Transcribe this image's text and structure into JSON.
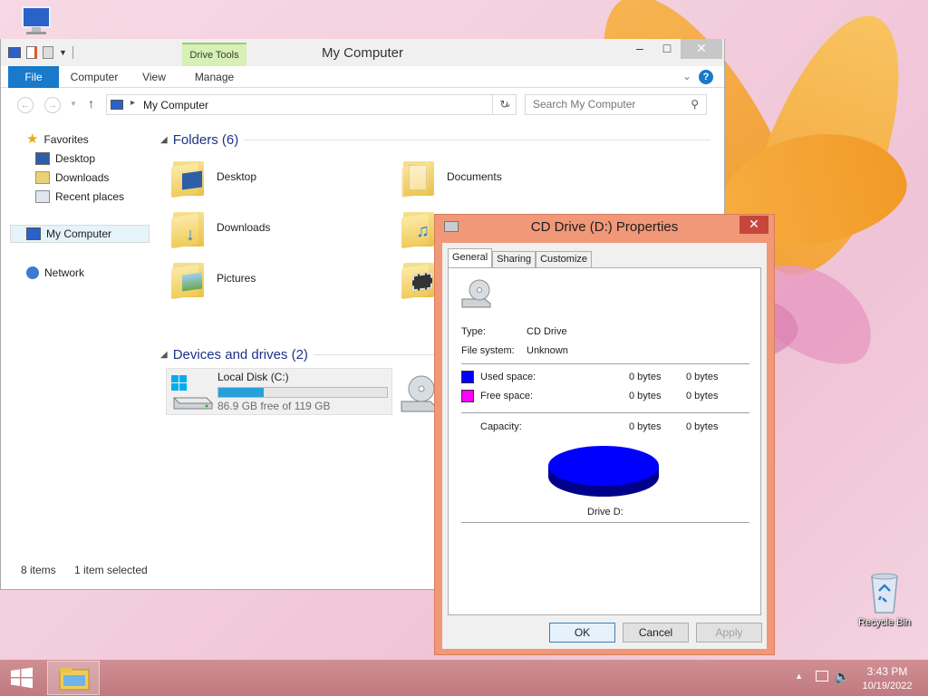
{
  "desktop": {
    "recycle_bin_label": "Recycle Bin"
  },
  "explorer": {
    "title": "My Computer",
    "context_tab": "Drive Tools",
    "ribbon_tabs": [
      "File",
      "Computer",
      "View",
      "Manage"
    ],
    "address": "My Computer",
    "search_placeholder": "Search My Computer",
    "nav": {
      "favorites": "Favorites",
      "desktop": "Desktop",
      "downloads": "Downloads",
      "recent": "Recent places",
      "my_computer": "My Computer",
      "network": "Network"
    },
    "folders_header": "Folders (6)",
    "folders": [
      "Desktop",
      "Documents",
      "Downloads",
      "Music",
      "Pictures",
      "Videos"
    ],
    "devices_header": "Devices and drives (2)",
    "local_disk": {
      "name": "Local Disk (C:)",
      "free_text": "86.9 GB free of 119 GB",
      "used_fraction": 0.27
    },
    "status_items": "8 items",
    "status_selected": "1 item selected"
  },
  "dialog": {
    "title": "CD Drive (D:) Properties",
    "tabs": [
      "General",
      "Sharing",
      "Customize"
    ],
    "type_label": "Type:",
    "type_value": "CD Drive",
    "fs_label": "File system:",
    "fs_value": "Unknown",
    "used_label": "Used space:",
    "used_bytes": "0 bytes",
    "used_bytes2": "0 bytes",
    "free_label": "Free space:",
    "free_bytes": "0 bytes",
    "free_bytes2": "0 bytes",
    "capacity_label": "Capacity:",
    "capacity_bytes": "0 bytes",
    "capacity_bytes2": "0 bytes",
    "drive_label": "Drive D:",
    "used_color": "#0000ff",
    "free_color": "#ff00ff",
    "ok": "OK",
    "cancel": "Cancel",
    "apply": "Apply"
  },
  "taskbar": {
    "time": "3:43 PM",
    "date": "10/19/2022"
  }
}
